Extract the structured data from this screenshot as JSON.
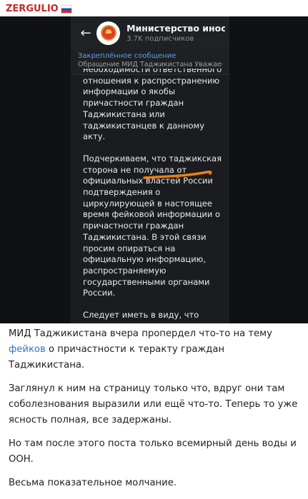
{
  "author": {
    "name": "ZERGULIO",
    "flag_icon": "russia-flag-icon"
  },
  "screenshot": {
    "header": {
      "back_icon": "arrow-left-icon",
      "channel_title": "Министерство иностр",
      "subscribers": "3.7K подписчиков"
    },
    "pinned": {
      "label": "Закреплённое сообщение",
      "text": "Обращение МИД Таджикистана  Уважаемы"
    },
    "message": {
      "paragraphs": [
        "необходимости ответственного отношения к распространению информации о якобы причастности граждан Таджикистана или таджикистанцев к данному акту.",
        "Подчеркиваем, что таджикская сторона не получала от официальных властей России подтверждения о циркулирующей в настоящее время фейковой информации о причастности граждан Таджикистана. В этой связи просим опираться на официальную информацию, распространяемую государственными органами России.",
        "Следует иметь в виду, что распространение непроверенной и недостоверной информации может нанести вред гражданам Таджикистана, находящимся в настоящее время за пределами страны."
      ]
    },
    "annotation_color": "#f07d14"
  },
  "post": {
    "p1_before": "МИД Таджикистана вчера пропердел что-то на тему ",
    "p1_link": "фейков",
    "p1_after": " о причастности к теракту граждан Таджикистана.",
    "p2": "Заглянул к ним на страницу только что, вдруг они там соболезнования выразили или ещё что-то. Теперь то уже ясность полная, все задержаны.",
    "p3": "Но там после этого поста только всемирный день воды и ООН.",
    "p4": "Весьма показательное молчание."
  }
}
